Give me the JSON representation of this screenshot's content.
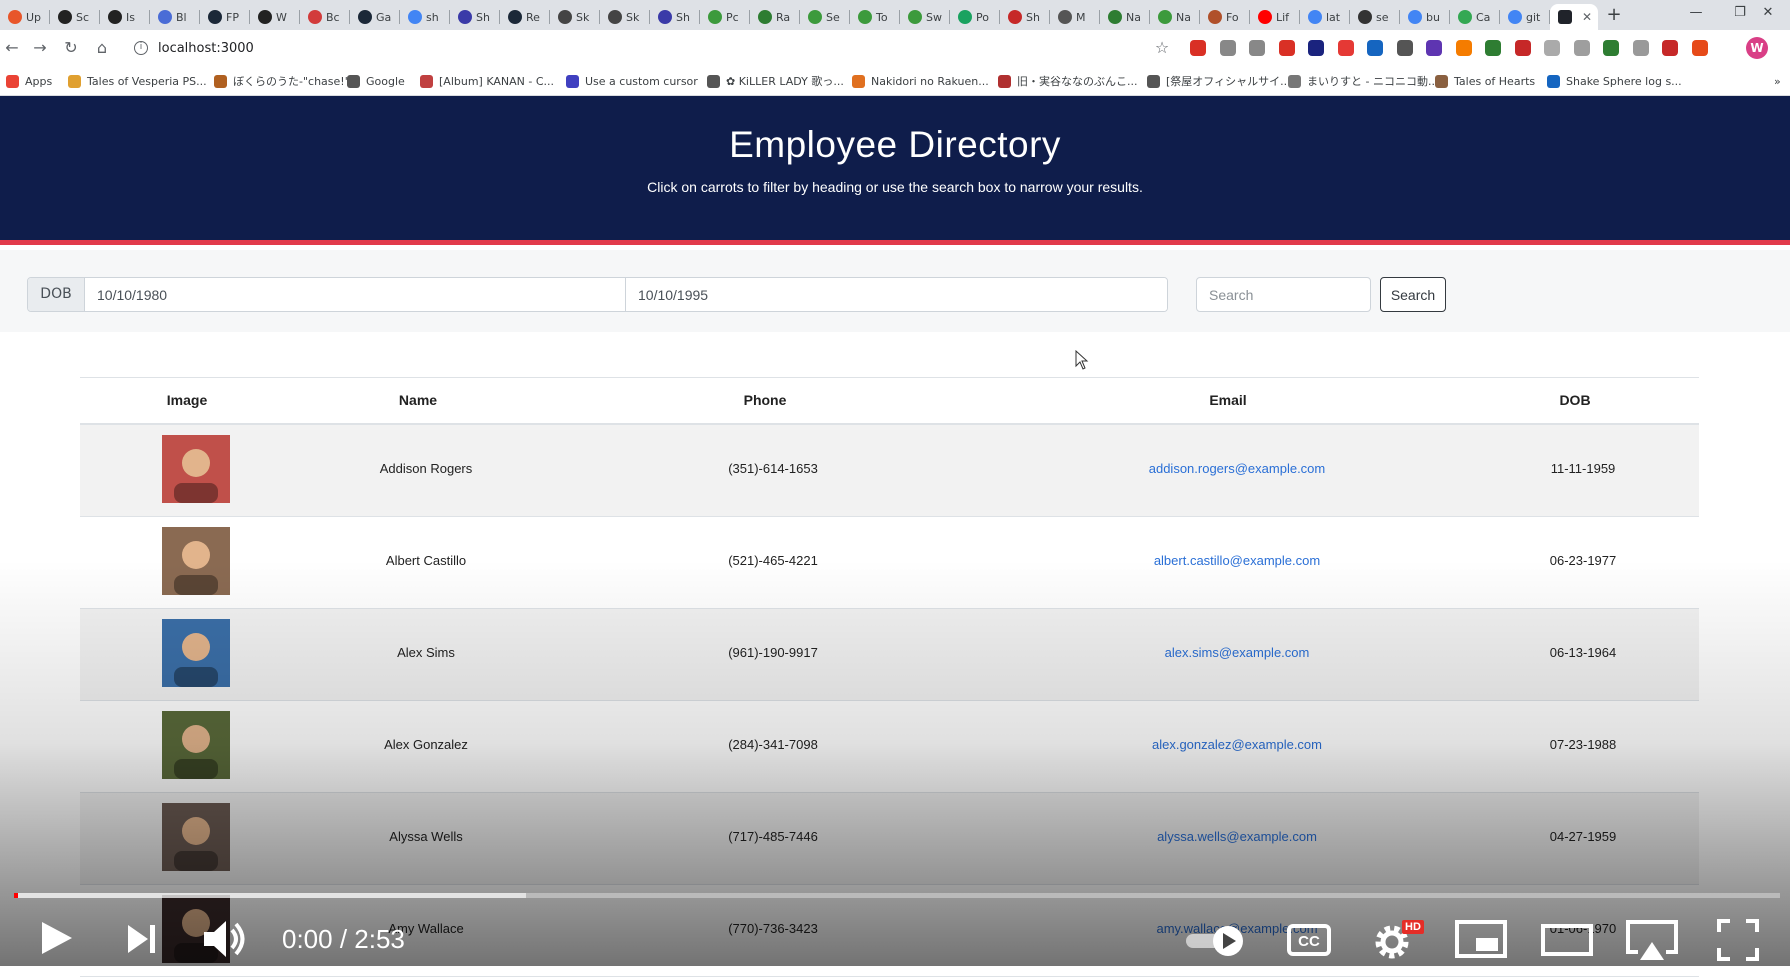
{
  "browser": {
    "tabs": [
      {
        "label": "Up",
        "color": "#e8562a"
      },
      {
        "label": "Sc",
        "color": "#222"
      },
      {
        "label": "Is",
        "color": "#222"
      },
      {
        "label": "Bl",
        "color": "#4a6cd6"
      },
      {
        "label": "FP",
        "color": "#1b2838"
      },
      {
        "label": "W",
        "color": "#222"
      },
      {
        "label": "Bc",
        "color": "#d23b3b"
      },
      {
        "label": "Ga",
        "color": "#1b2838"
      },
      {
        "label": "sh",
        "color": "#4285f4"
      },
      {
        "label": "Sh",
        "color": "#3a3aa8"
      },
      {
        "label": "Re",
        "color": "#1b2838"
      },
      {
        "label": "Sk",
        "color": "#444"
      },
      {
        "label": "Sk",
        "color": "#444"
      },
      {
        "label": "Sh",
        "color": "#3a3aa8"
      },
      {
        "label": "Pc",
        "color": "#3c9a3c"
      },
      {
        "label": "Ra",
        "color": "#2e7d32"
      },
      {
        "label": "Se",
        "color": "#3c9a3c"
      },
      {
        "label": "To",
        "color": "#3c9a3c"
      },
      {
        "label": "Sw",
        "color": "#3c9a3c"
      },
      {
        "label": "Po",
        "color": "#1aa260"
      },
      {
        "label": "Sh",
        "color": "#c62828"
      },
      {
        "label": "M",
        "color": "#555"
      },
      {
        "label": "Na",
        "color": "#2e7d32"
      },
      {
        "label": "Na",
        "color": "#3c9a3c"
      },
      {
        "label": "Fo",
        "color": "#b0502a"
      },
      {
        "label": "Lif",
        "color": "#ff0000"
      },
      {
        "label": "lat",
        "color": "#4285f4"
      },
      {
        "label": "se",
        "color": "#333"
      },
      {
        "label": "bu",
        "color": "#4285f4"
      },
      {
        "label": "Ca",
        "color": "#34a853"
      },
      {
        "label": "git",
        "color": "#4285f4"
      }
    ],
    "active_tab_icon": "react-app-icon",
    "address": "localhost:3000",
    "bookmarks": [
      {
        "label": "Apps",
        "color": "#ea4335"
      },
      {
        "label": "Tales of Vesperia PS...",
        "color": "#e0a030"
      },
      {
        "label": "ぼくらのうた-\"chase!\"",
        "color": "#b06020"
      },
      {
        "label": "Google",
        "color": "#555"
      },
      {
        "label": "[Album] KANAN - C...",
        "color": "#c04040"
      },
      {
        "label": "Use a custom cursor",
        "color": "#4040c0"
      },
      {
        "label": "✿ KiLLER LADY 歌っ...",
        "color": "#555"
      },
      {
        "label": "Nakidori no Rakuen...",
        "color": "#e07020"
      },
      {
        "label": "旧・実谷ななのぶんこ...",
        "color": "#b03030"
      },
      {
        "label": "[祭屋オフィシャルサイ...",
        "color": "#555"
      },
      {
        "label": "まいりすと - ニコニコ動...",
        "color": "#777"
      },
      {
        "label": "Tales of Hearts",
        "color": "#8a6040"
      },
      {
        "label": "Shake Sphere log s...",
        "color": "#1565c0"
      }
    ]
  },
  "header": {
    "title": "Employee Directory",
    "subtitle": "Click on carrots to filter by heading or use the search box to narrow your results."
  },
  "filters": {
    "dob_label": "DOB",
    "dob_start": "10/10/1980",
    "dob_end": "10/10/1995",
    "search_placeholder": "Search",
    "search_button": "Search"
  },
  "table": {
    "columns": [
      "Image",
      "Name",
      "Phone",
      "Email",
      "DOB"
    ],
    "rows": [
      {
        "name": "Addison Rogers",
        "phone": "(351)-614-1653",
        "email": "addison.rogers@example.com",
        "dob": "11-11-1959",
        "photo": "#c0504a"
      },
      {
        "name": "Albert Castillo",
        "phone": "(521)-465-4221",
        "email": "albert.castillo@example.com",
        "dob": "06-23-1977",
        "photo": "#8a6a52"
      },
      {
        "name": "Alex Sims",
        "phone": "(961)-190-9917",
        "email": "alex.sims@example.com",
        "dob": "06-13-1964",
        "photo": "#3b6fa8"
      },
      {
        "name": "Alex Gonzalez",
        "phone": "(284)-341-7098",
        "email": "alex.gonzalez@example.com",
        "dob": "07-23-1988",
        "photo": "#5a6a3a"
      },
      {
        "name": "Alyssa Wells",
        "phone": "(717)-485-7446",
        "email": "alyssa.wells@example.com",
        "dob": "04-27-1959",
        "photo": "#6a5a52"
      },
      {
        "name": "Amy Wallace",
        "phone": "(770)-736-3423",
        "email": "amy.wallace@example.com",
        "dob": "01-06-1970",
        "photo": "#3a2a2a"
      }
    ]
  },
  "video": {
    "time": "0:00 / 2:53",
    "hd_label": "HD",
    "played_fraction": 0.0,
    "buffered_fraction": 0.29
  }
}
